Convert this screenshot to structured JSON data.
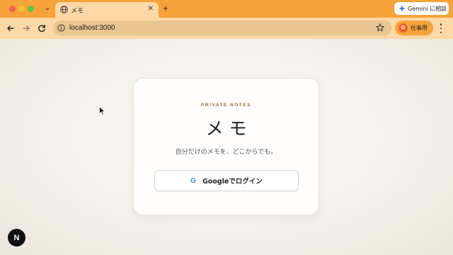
{
  "browser": {
    "tab": {
      "title": "メモ",
      "favicon": "globe-icon"
    },
    "gemini_label": "Gemini に相談",
    "url": "localhost:3000",
    "profile": {
      "initial": "G",
      "label": "仕事用",
      "color": "#e8642c"
    },
    "accent_color": "#f6a33a"
  },
  "card": {
    "eyebrow": "PRIVATE NOTES",
    "title": "メモ",
    "subtitle": "自分だけのメモを、どこからでも。",
    "google_icon_letter": "G",
    "login_button": "Googleでログイン"
  },
  "next_badge": "N"
}
